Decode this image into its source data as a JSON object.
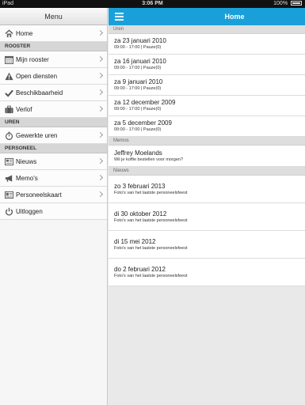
{
  "statusbar": {
    "carrier": "iPad",
    "time": "3:06 PM",
    "battery": "100%"
  },
  "sidebar": {
    "header": "Menu",
    "home": {
      "label": "Home",
      "icon": "house-icon"
    },
    "sections": [
      {
        "title": "ROOSTER",
        "items": [
          {
            "label": "Mijn rooster",
            "icon": "calendar-icon"
          },
          {
            "label": "Open diensten",
            "icon": "warning-icon"
          },
          {
            "label": "Beschikbaarheid",
            "icon": "checkmark-icon"
          },
          {
            "label": "Verlof",
            "icon": "suitcase-icon"
          }
        ]
      },
      {
        "title": "UREN",
        "items": [
          {
            "label": "Gewerkte uren",
            "icon": "stopwatch-icon"
          }
        ]
      },
      {
        "title": "PERSONEEL",
        "items": [
          {
            "label": "Nieuws",
            "icon": "newspaper-icon"
          },
          {
            "label": "Memo's",
            "icon": "megaphone-icon"
          },
          {
            "label": "Personeelskaart",
            "icon": "id-card-icon"
          },
          {
            "label": "Uitloggen",
            "icon": "power-icon"
          }
        ]
      }
    ]
  },
  "main": {
    "title": "Home",
    "uren": {
      "header": "Uren",
      "items": [
        {
          "date": "za 23 januari 2010",
          "detail": "09:00 - 17:00 | Pauze(0)"
        },
        {
          "date": "za 16 januari 2010",
          "detail": "09:00 - 17:00 | Pauze(0)"
        },
        {
          "date": "za 9 januari 2010",
          "detail": "09:00 - 17:00 | Pauze(0)"
        },
        {
          "date": "za 12 december 2009",
          "detail": "09:00 - 17:00 | Pauze(0)"
        },
        {
          "date": "za 5 december 2009",
          "detail": "09:00 - 17:00 | Pauze(0)"
        }
      ]
    },
    "memos": {
      "header": "Memos",
      "items": [
        {
          "author": "Jeffrey Moelands",
          "text": "Wil je koffie bestellen voor morgen?"
        }
      ]
    },
    "nieuws": {
      "header": "Nieuws",
      "items": [
        {
          "date": "zo 3 februari 2013",
          "text": "Foto's van het laatste personeelsfeest"
        },
        {
          "date": "di 30 oktober 2012",
          "text": "Foto's van het laatste personeelsfeest"
        },
        {
          "date": "di 15 mei 2012",
          "text": "Foto's van het laatste personeelsfeest"
        },
        {
          "date": "do 2 februari 2012",
          "text": "Foto's van het laatste personeelsfeest"
        }
      ]
    }
  },
  "colors": {
    "accent": "#1aa0d8"
  }
}
